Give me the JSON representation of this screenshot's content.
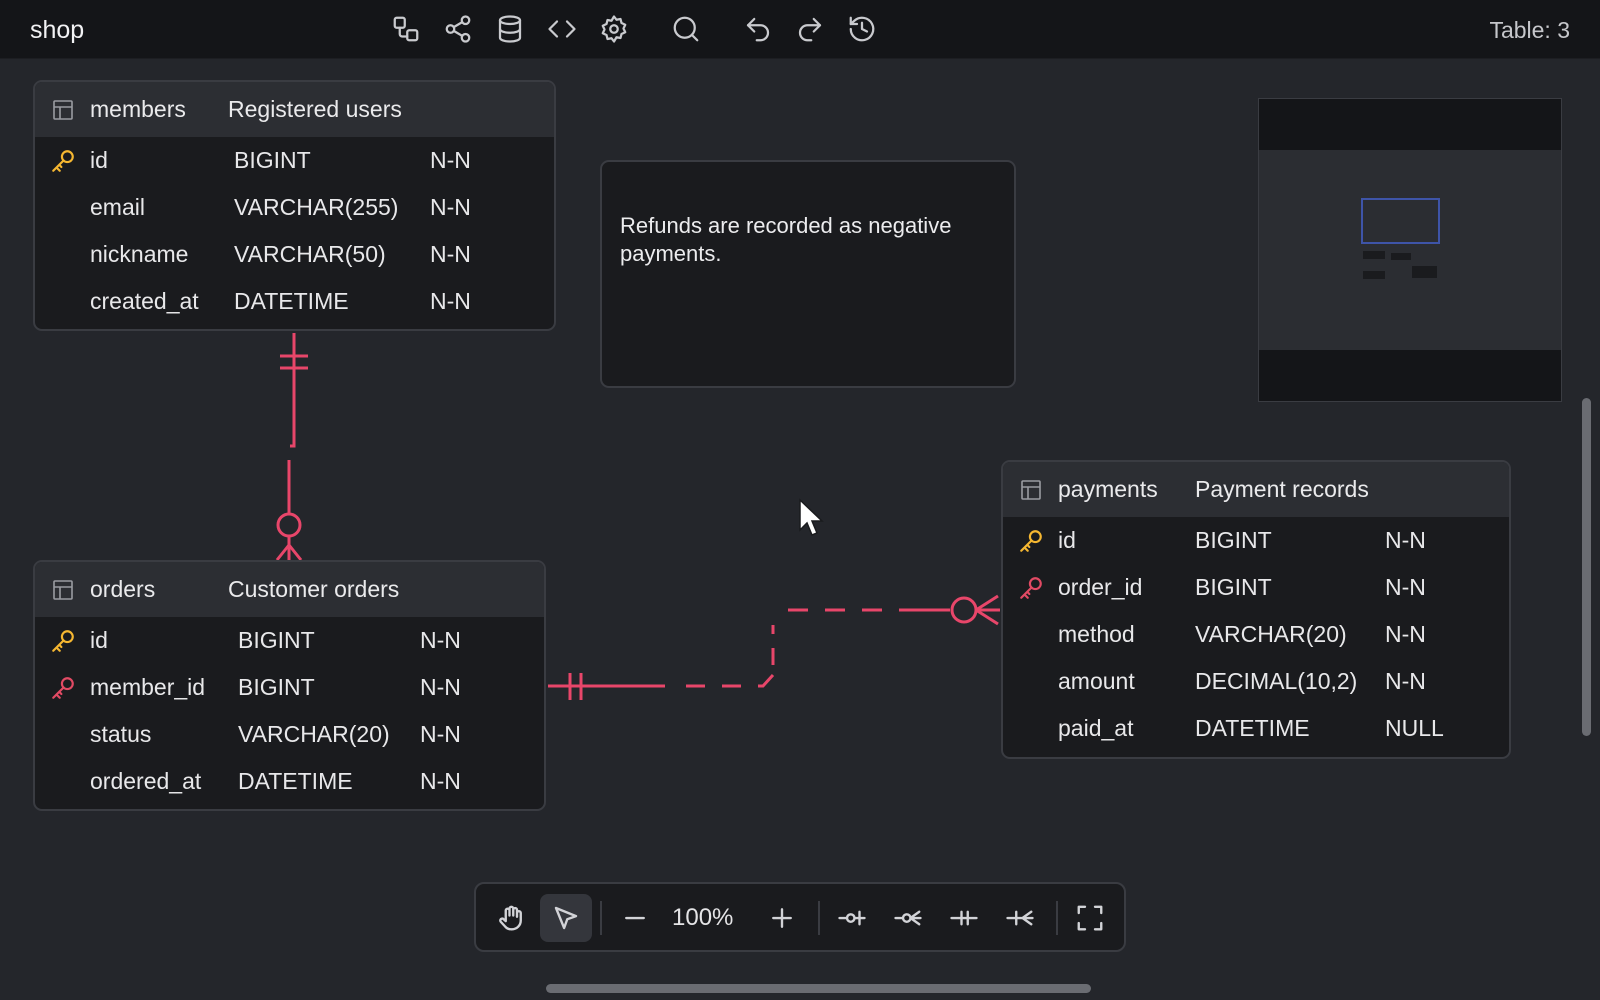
{
  "app": {
    "title": "shop",
    "table_count": "Table: 3"
  },
  "toolbar": {
    "icons": [
      "diagram-icon",
      "share-icon",
      "database-icon",
      "code-icon",
      "gear-icon",
      "search-icon",
      "undo-icon",
      "redo-icon",
      "history-icon"
    ]
  },
  "tables": {
    "members": {
      "name": "members",
      "comment": "Registered users",
      "rows": [
        {
          "name": "id",
          "type": "BIGINT",
          "nullability": "N-N",
          "key": "primary"
        },
        {
          "name": "email",
          "type": "VARCHAR(255)",
          "nullability": "N-N",
          "key": ""
        },
        {
          "name": "nickname",
          "type": "VARCHAR(50)",
          "nullability": "N-N",
          "key": ""
        },
        {
          "name": "created_at",
          "type": "DATETIME",
          "nullability": "N-N",
          "key": ""
        }
      ]
    },
    "orders": {
      "name": "orders",
      "comment": "Customer orders",
      "rows": [
        {
          "name": "id",
          "type": "BIGINT",
          "nullability": "N-N",
          "key": "primary"
        },
        {
          "name": "member_id",
          "type": "BIGINT",
          "nullability": "N-N",
          "key": "foreign"
        },
        {
          "name": "status",
          "type": "VARCHAR(20)",
          "nullability": "N-N",
          "key": ""
        },
        {
          "name": "ordered_at",
          "type": "DATETIME",
          "nullability": "N-N",
          "key": ""
        }
      ]
    },
    "payments": {
      "name": "payments",
      "comment": "Payment records",
      "rows": [
        {
          "name": "id",
          "type": "BIGINT",
          "nullability": "N-N",
          "key": "primary"
        },
        {
          "name": "order_id",
          "type": "BIGINT",
          "nullability": "N-N",
          "key": "foreign"
        },
        {
          "name": "method",
          "type": "VARCHAR(20)",
          "nullability": "N-N",
          "key": ""
        },
        {
          "name": "amount",
          "type": "DECIMAL(10,2)",
          "nullability": "N-N",
          "key": ""
        },
        {
          "name": "paid_at",
          "type": "DATETIME",
          "nullability": "NULL",
          "key": ""
        }
      ]
    }
  },
  "note": {
    "text": "Refunds are recorded as negative payments."
  },
  "relations": [
    {
      "from": "members.id",
      "to": "orders.member_id",
      "style": "solid"
    },
    {
      "from": "orders.id",
      "to": "payments.order_id",
      "style": "dashed"
    }
  ],
  "bottom_toolbar": {
    "zoom": "100%",
    "active_tool": "select"
  },
  "colors": {
    "primary_key": "#f5b731",
    "foreign_key": "#e24a64",
    "relation": "#e8466a",
    "minimap_frame": "#3e54a8"
  }
}
